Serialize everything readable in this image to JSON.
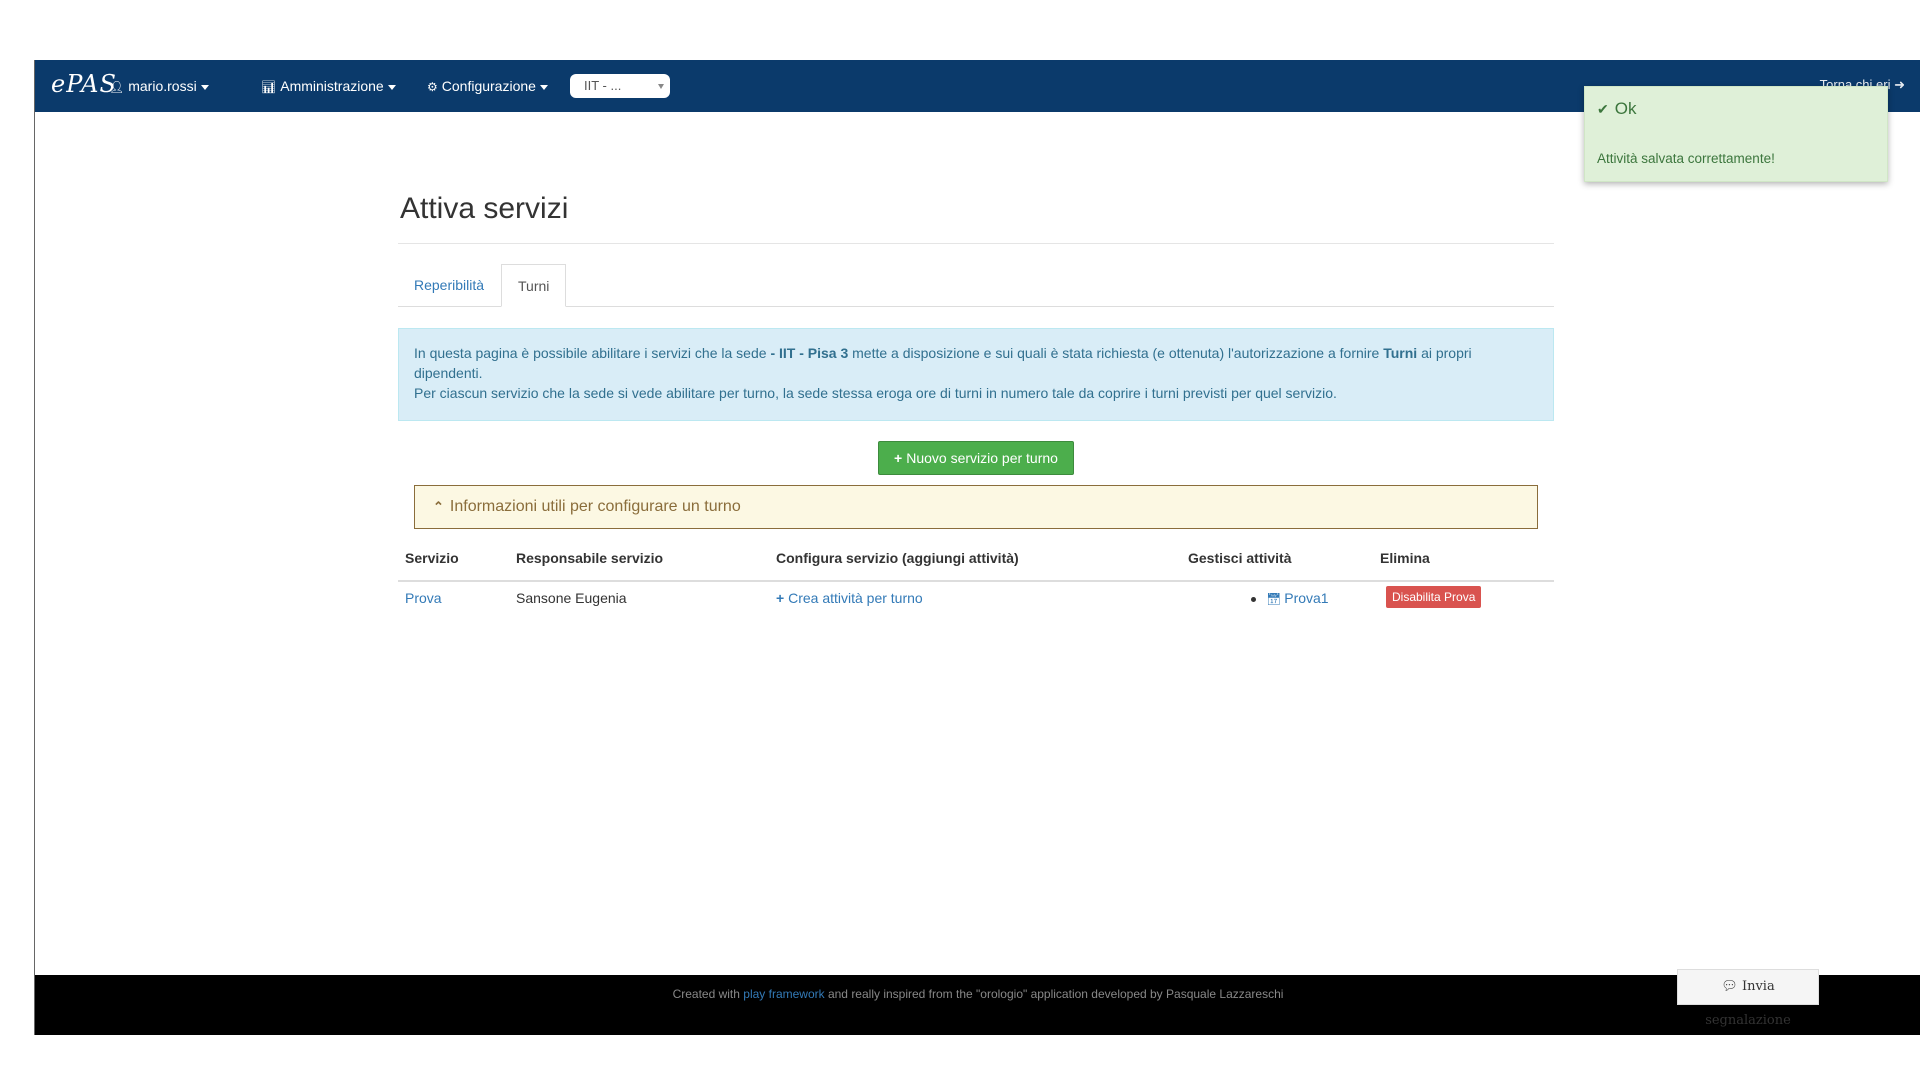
{
  "navbar": {
    "brand": "ePAS",
    "user_menu": "mario.rossi",
    "admin_menu": "Amministrazione",
    "config_menu": "Configurazione",
    "office_select": "IIT - ...",
    "logout_text": "Torna chi eri"
  },
  "toast": {
    "title": "Ok",
    "message": "Attività salvata correttamente!"
  },
  "page": {
    "title": "Attiva servizi",
    "tabs": [
      {
        "label": "Reperibilità",
        "active": false
      },
      {
        "label": "Turni",
        "active": true
      }
    ],
    "info": {
      "line1_pre": "In questa pagina è possibile abilitare i servizi che la sede ",
      "office": "- IIT - Pisa 3",
      "line1_mid": " mette a disposizione e sui quali è stata richiesta (e ottenuta) l'autorizzazione a fornire ",
      "service_type": "Turni",
      "line1_post": " ai propri dipendenti.",
      "line2": "Per ciascun servizio che la sede si vede abilitare per turno, la sede stessa eroga ore di turni in numero tale da coprire i turni previsti per quel servizio."
    },
    "new_button": "Nuovo servizio per turno",
    "collapsible": "Informazioni utili per configurare un turno",
    "table": {
      "headers": [
        "Servizio",
        "Responsabile servizio",
        "Configura servizio (aggiungi attività)",
        "Gestisci attività",
        "Elimina"
      ],
      "rows": [
        {
          "service": "Prova",
          "manager": "Sansone Eugenia",
          "configure": "Crea attività per turno",
          "activity": "Prova1",
          "delete": "Disabilita Prova"
        }
      ]
    }
  },
  "footer": {
    "pre": "Created with ",
    "link": "play framework",
    "post": " and really inspired from the \"orologio\" application developed by Pasquale Lazzareschi",
    "report_button": "Invia segnalazione"
  },
  "colors": {
    "navbar": "#0b3a6b",
    "success": "#4cae4c",
    "danger": "#d9534f",
    "info_bg": "#d9edf7",
    "warning_bg": "#fcf8e3"
  }
}
